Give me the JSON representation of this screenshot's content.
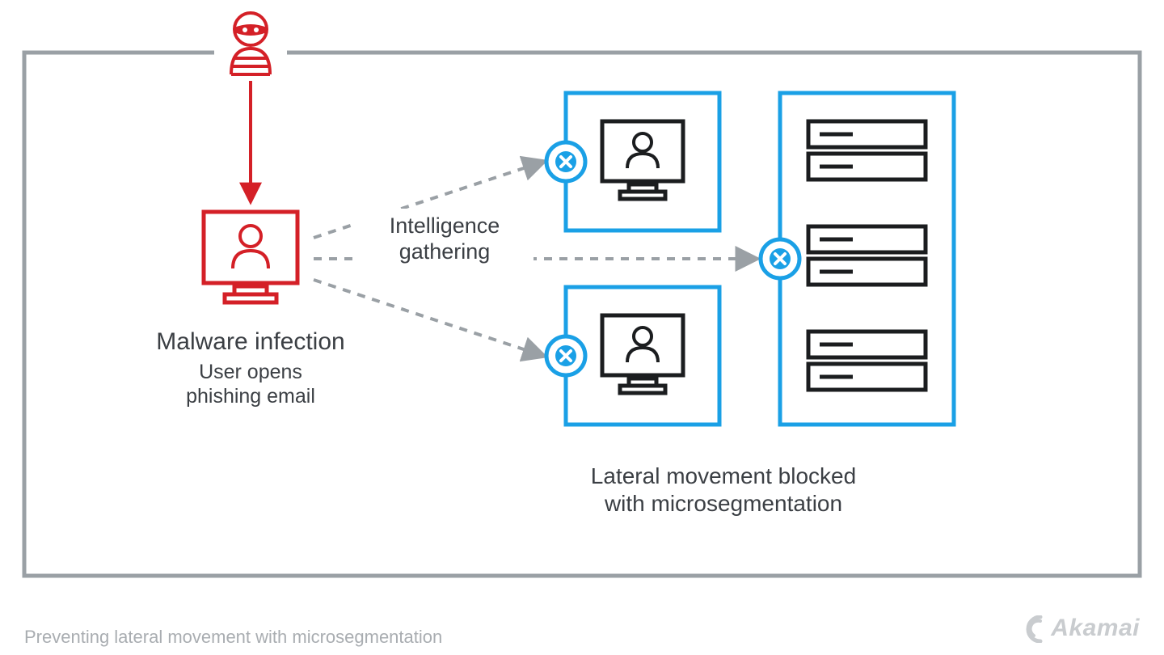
{
  "colors": {
    "border_gray": "#9aa0a5",
    "text_gray": "#3b3f44",
    "caption_gray": "#a9adb1",
    "blue": "#1aa0e6",
    "red": "#d42027",
    "black": "#1b1d1f"
  },
  "labels": {
    "malware_title": "Malware infection",
    "malware_sub1": "User opens",
    "malware_sub2": "phishing email",
    "intel1": "Intelligence",
    "intel2": "gathering",
    "lateral1": "Lateral movement blocked",
    "lateral2": "with microsegmentation",
    "caption": "Preventing lateral movement with microsegmentation",
    "logo": "Akamai"
  }
}
